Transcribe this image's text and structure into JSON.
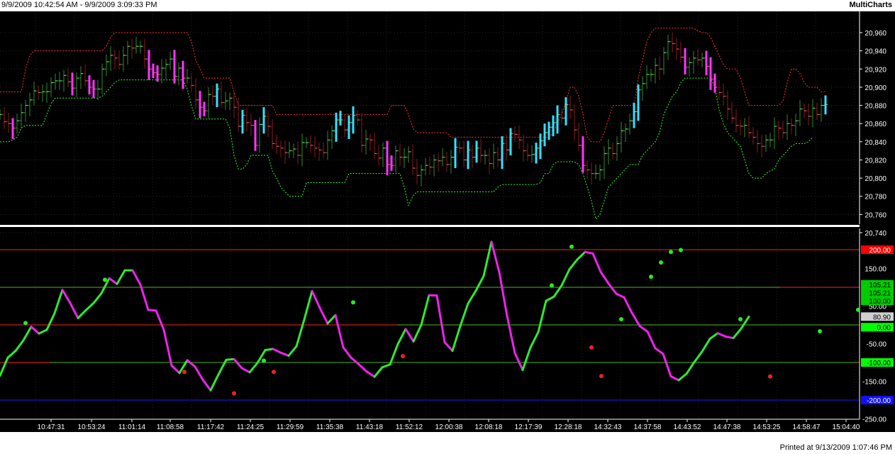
{
  "header": {
    "range": "9/9/2009 10:42:54 AM - 9/9/2009 3:09:33 PM",
    "app": "MultiCharts"
  },
  "footer": {
    "printed": "Printed at 9/13/2009 1:07:46 PM"
  },
  "colors": {
    "background": "#000000",
    "up_bar": "#2e8b2e",
    "down_bar": "#8b1a1a",
    "cyan": "#33e0ff",
    "magenta": "#ff33ff",
    "upper_band": "#ff3030",
    "lower_band": "#30ff30",
    "osc_up": "#2eea2e",
    "osc_down": "#ee22ee"
  },
  "chart_data": [
    {
      "type": "bar",
      "subtype": "ohlc-with-bands",
      "y_tick_labels": [
        "20,960",
        "20,940",
        "20,920",
        "20,900",
        "20,880",
        "20,860",
        "20,840",
        "20,820",
        "20,800",
        "20,780",
        "20,760",
        "20,740"
      ],
      "ylim": [
        20740,
        20970
      ],
      "x": [
        0,
        6,
        12,
        18,
        24,
        30,
        36,
        42,
        48,
        54,
        60,
        66,
        72,
        78,
        84,
        90,
        96,
        102,
        108,
        114,
        120,
        126,
        132,
        138,
        144,
        150,
        156,
        162,
        168,
        174,
        180,
        186,
        192,
        198,
        204,
        210,
        216,
        222,
        228,
        234,
        240,
        246,
        252,
        258,
        264,
        270,
        276,
        282,
        288,
        294,
        300,
        306,
        312,
        318,
        324,
        330,
        336,
        342,
        348,
        354,
        360,
        366,
        372,
        378,
        384,
        390,
        396,
        402,
        408,
        414,
        420,
        426,
        432,
        438,
        444,
        450,
        456,
        462,
        468,
        474,
        480,
        486,
        492,
        498,
        504,
        510,
        516,
        522,
        528,
        534,
        540,
        546,
        552,
        558,
        564,
        570,
        576,
        582,
        588,
        594,
        600,
        606,
        612,
        618,
        624,
        630,
        636,
        642,
        648,
        654,
        660,
        666,
        672,
        678,
        684,
        690,
        696,
        702,
        708,
        714,
        720,
        726,
        732,
        738,
        744,
        750,
        756,
        762,
        768,
        774,
        780,
        786,
        792,
        798,
        804,
        810,
        816,
        822,
        828,
        834,
        840,
        846,
        852,
        858,
        864,
        870,
        876,
        882,
        888,
        894,
        900,
        906,
        912,
        918,
        924,
        930,
        936,
        942,
        948,
        954,
        960,
        966,
        972,
        978,
        984,
        990,
        996,
        1002,
        1008,
        1014,
        1020,
        1026,
        1032,
        1038,
        1044,
        1050,
        1056,
        1062,
        1068,
        1074,
        1080,
        1086,
        1092,
        1098,
        1104,
        1110,
        1116,
        1122,
        1128,
        1134,
        1140,
        1146,
        1152,
        1158,
        1164,
        1170,
        1176,
        1182,
        1188,
        1194,
        1200
      ],
      "close": [
        20870,
        20862,
        20860,
        20855,
        20863,
        20872,
        20880,
        20886,
        20896,
        20894,
        20895,
        20895,
        20905,
        20907,
        20907,
        20913,
        20906,
        20899,
        20910,
        20915,
        20907,
        20900,
        20898,
        20898,
        20920,
        20928,
        20935,
        20932,
        20925,
        20935,
        20945,
        20943,
        20945,
        20945,
        20931,
        20920,
        20916,
        20914,
        20921,
        20925,
        20931,
        20912,
        20921,
        20910,
        20910,
        20902,
        20886,
        20878,
        20874,
        20892,
        20890,
        20898,
        20883,
        20885,
        20888,
        20878,
        20857,
        20869,
        20861,
        20858,
        20836,
        20859,
        20868,
        20857,
        20838,
        20835,
        20833,
        20828,
        20830,
        20832,
        20825,
        20839,
        20839,
        20836,
        20833,
        20831,
        20828,
        20842,
        20852,
        20864,
        20864,
        20853,
        20861,
        20869,
        20864,
        20836,
        20843,
        20842,
        20827,
        20822,
        20833,
        20815,
        20814,
        20830,
        20823,
        20823,
        20829,
        20811,
        20803,
        20809,
        20814,
        20812,
        20820,
        20819,
        20823,
        20815,
        20823,
        20834,
        20833,
        20820,
        20831,
        20823,
        20833,
        20825,
        20825,
        20816,
        20828,
        20820,
        20838,
        20831,
        20849,
        20848,
        20842,
        20830,
        20825,
        20826,
        20833,
        20841,
        20850,
        20856,
        20861,
        20870,
        20866,
        20881,
        20875,
        20853,
        20836,
        20814,
        20809,
        20805,
        20805,
        20809,
        20827,
        20833,
        20827,
        20838,
        20852,
        20854,
        20863,
        20873,
        20897,
        20904,
        20914,
        20914,
        20924,
        20920,
        20938,
        20950,
        20948,
        20942,
        20933,
        20922,
        20927,
        20932,
        20930,
        20932,
        20923,
        20909,
        20900,
        20894,
        20890,
        20876,
        20866,
        20858,
        20857,
        20858,
        20850,
        20845,
        20838,
        20835,
        20842,
        20842,
        20857,
        20855,
        20850,
        20860,
        20858,
        20863,
        20876,
        20874,
        20868,
        20877,
        20870,
        20880,
        20881
      ],
      "upper_band": [
        20895,
        20895,
        20895,
        20895,
        20895,
        20895,
        20920,
        20935,
        20940,
        20940,
        20940,
        20940,
        20940,
        20940,
        20940,
        20940,
        20940,
        20940,
        20940,
        20940,
        20940,
        20940,
        20940,
        20940,
        20940,
        20945,
        20955,
        20960,
        20960,
        20960,
        20960,
        20960,
        20960,
        20960,
        20960,
        20960,
        20960,
        20960,
        20960,
        20960,
        20960,
        20960,
        20960,
        20960,
        20960,
        20950,
        20930,
        20920,
        20910,
        20910,
        20910,
        20910,
        20910,
        20910,
        20910,
        20895,
        20880,
        20880,
        20880,
        20880,
        20880,
        20880,
        20880,
        20880,
        20880,
        20870,
        20870,
        20870,
        20870,
        20870,
        20870,
        20870,
        20870,
        20870,
        20870,
        20870,
        20870,
        20870,
        20870,
        20870,
        20870,
        20870,
        20870,
        20870,
        20870,
        20870,
        20870,
        20870,
        20870,
        20870,
        20870,
        20870,
        20880,
        20880,
        20880,
        20880,
        20870,
        20855,
        20850,
        20850,
        20850,
        20850,
        20850,
        20850,
        20850,
        20850,
        20845,
        20845,
        20845,
        20845,
        20845,
        20845,
        20845,
        20845,
        20845,
        20845,
        20845,
        20845,
        20845,
        20845,
        20845,
        20845,
        20845,
        20845,
        20845,
        20845,
        20845,
        20845,
        20845,
        20845,
        20850,
        20860,
        20870,
        20885,
        20900,
        20900,
        20890,
        20870,
        20845,
        20840,
        20840,
        20840,
        20850,
        20865,
        20880,
        20880,
        20880,
        20880,
        20880,
        20880,
        20910,
        20930,
        20950,
        20960,
        20965,
        20965,
        20965,
        20965,
        20965,
        20965,
        20965,
        20965,
        20965,
        20965,
        20962,
        20960,
        20960,
        20955,
        20945,
        20935,
        20925,
        20920,
        20920,
        20920,
        20910,
        20895,
        20880,
        20880,
        20880,
        20880,
        20880,
        20880,
        20880,
        20880,
        20885,
        20905,
        20920,
        20920,
        20915,
        20905,
        20900,
        20900,
        20900,
        20895,
        20895
      ],
      "lower_band": [
        20840,
        20840,
        20840,
        20842,
        20845,
        20855,
        20858,
        20858,
        20858,
        20858,
        20858,
        20870,
        20882,
        20888,
        20888,
        20888,
        20888,
        20888,
        20888,
        20888,
        20888,
        20888,
        20888,
        20888,
        20890,
        20895,
        20900,
        20905,
        20908,
        20908,
        20908,
        20908,
        20908,
        20908,
        20908,
        20908,
        20908,
        20908,
        20908,
        20908,
        20908,
        20908,
        20908,
        20908,
        20898,
        20880,
        20865,
        20865,
        20865,
        20865,
        20865,
        20865,
        20865,
        20865,
        20855,
        20825,
        20810,
        20810,
        20815,
        20825,
        20825,
        20825,
        20825,
        20825,
        20808,
        20800,
        20790,
        20785,
        20780,
        20780,
        20780,
        20780,
        20795,
        20795,
        20795,
        20795,
        20795,
        20795,
        20795,
        20795,
        20795,
        20795,
        20805,
        20805,
        20805,
        20805,
        20805,
        20805,
        20805,
        20805,
        20805,
        20805,
        20805,
        20805,
        20805,
        20790,
        20770,
        20780,
        20785,
        20785,
        20785,
        20785,
        20785,
        20785,
        20785,
        20785,
        20785,
        20785,
        20785,
        20785,
        20785,
        20785,
        20785,
        20785,
        20785,
        20785,
        20785,
        20790,
        20793,
        20793,
        20793,
        20793,
        20793,
        20793,
        20793,
        20793,
        20793,
        20795,
        20805,
        20805,
        20815,
        20818,
        20818,
        20818,
        20818,
        20818,
        20815,
        20805,
        20790,
        20775,
        20755,
        20760,
        20775,
        20790,
        20795,
        20800,
        20805,
        20810,
        20815,
        20815,
        20815,
        20825,
        20830,
        20835,
        20840,
        20850,
        20870,
        20880,
        20890,
        20895,
        20905,
        20910,
        20910,
        20910,
        20910,
        20910,
        20910,
        20910,
        20900,
        20875,
        20860,
        20850,
        20845,
        20840,
        20835,
        20820,
        20805,
        20800,
        20800,
        20800,
        20805,
        20808,
        20810,
        20820,
        20825,
        20830,
        20835,
        20838,
        20838,
        20838,
        20840,
        20845
      ]
    },
    {
      "type": "line",
      "subtype": "oscillator",
      "x_tick_labels": [
        "10:47:31",
        "10:53:24",
        "11:01:14",
        "11:08:58",
        "11:17:42",
        "11:24:25",
        "11:29:59",
        "11:35:38",
        "11:43:18",
        "11:52:12",
        "12:00:38",
        "12:08:18",
        "12:17:39",
        "12:28:18",
        "14:32:43",
        "14:37:58",
        "14:43:52",
        "14:47:38",
        "14:53:25",
        "14:58:47",
        "15:04:40"
      ],
      "y_tick_labels": [
        "150.00",
        "50.00",
        "-50.00",
        "-150.00",
        "-250.00"
      ],
      "ylim": [
        -250,
        240
      ],
      "reference_lines": [
        {
          "value": 200,
          "color": "#ff2020"
        },
        {
          "value": 100,
          "color": "#ff2020"
        },
        {
          "value": 0,
          "color": "#ff2020"
        },
        {
          "value": -100,
          "color": "#ff2020"
        },
        {
          "value": -200,
          "color": "#1a1aff"
        }
      ],
      "right_labels": [
        {
          "text": "200.00",
          "value": 200,
          "bg": "#ff0000",
          "fg": "#ffffff"
        },
        {
          "text": "105.21",
          "value": 108,
          "bg": "#00cc00",
          "fg": "#000000"
        },
        {
          "text": "105.21",
          "value": 86,
          "bg": "#00cc00",
          "fg": "#000000"
        },
        {
          "text": "100.00",
          "value": 64,
          "bg": "#00cc00",
          "fg": "#000000"
        },
        {
          "text": "80.90",
          "value": 22,
          "bg": "#d0d0d0",
          "fg": "#000000"
        },
        {
          "text": "0.00",
          "value": -6,
          "bg": "#00ff00",
          "fg": "#000000"
        },
        {
          "text": "-100.00",
          "value": -100,
          "bg": "#00ff00",
          "fg": "#000000"
        },
        {
          "text": "-200.00",
          "value": -200,
          "bg": "#1010ff",
          "fg": "#ffffff"
        }
      ],
      "x": [
        0,
        11,
        22,
        33,
        44,
        55,
        66,
        77,
        88,
        99,
        110,
        121,
        132,
        143,
        154,
        165,
        176,
        187,
        198,
        209,
        220,
        231,
        242,
        253,
        264,
        275,
        286,
        297,
        308,
        319,
        330,
        341,
        352,
        363,
        374,
        385,
        396,
        407,
        418,
        429,
        440,
        451,
        462,
        473,
        484,
        495,
        506,
        517,
        528,
        539,
        550,
        561,
        572,
        583,
        594,
        605,
        616,
        627,
        638,
        649,
        660,
        671,
        682,
        693,
        704,
        715,
        726,
        737,
        748,
        759,
        770,
        781,
        792,
        803,
        814,
        825,
        836,
        847,
        858,
        869,
        880,
        891,
        902,
        913,
        924,
        935,
        946,
        957,
        968,
        979,
        990,
        1001,
        1012,
        1023,
        1034,
        1045,
        1056,
        1067,
        1078,
        1089,
        1100,
        1111,
        1122,
        1133,
        1144,
        1155,
        1166,
        1177,
        1188,
        1199,
        1210
      ],
      "values": [
        -135,
        -87,
        -69,
        -41,
        -5,
        -23,
        -13,
        31,
        93,
        58,
        18,
        39,
        58,
        84,
        124,
        109,
        145,
        145,
        107,
        40,
        38,
        -13,
        -108,
        -128,
        -94,
        -111,
        -146,
        -174,
        -132,
        -93,
        -91,
        -115,
        -126,
        -101,
        -67,
        -64,
        -74,
        -82,
        -57,
        14,
        90,
        45,
        4,
        26,
        -60,
        -87,
        -105,
        -124,
        -138,
        -113,
        -105,
        -51,
        -11,
        -44,
        0,
        79,
        78,
        -46,
        -69,
        -3,
        57,
        91,
        130,
        221,
        140,
        24,
        -75,
        -120,
        -60,
        -19,
        64,
        75,
        105,
        148,
        174,
        194,
        190,
        141,
        110,
        83,
        73,
        32,
        -3,
        -18,
        -62,
        -77,
        -137,
        -147,
        -130,
        -99,
        -71,
        -37,
        -22,
        -31,
        -35,
        -10,
        22
      ],
      "dots": [
        {
          "x": 36,
          "value": 5
        },
        {
          "x": 148,
          "value": 120
        },
        {
          "x": 260,
          "value": -125
        },
        {
          "x": 330,
          "value": -182
        },
        {
          "x": 372,
          "value": -95
        },
        {
          "x": 386,
          "value": -125
        },
        {
          "x": 498,
          "value": 60
        },
        {
          "x": 568,
          "value": -83
        },
        {
          "x": 778,
          "value": 105
        },
        {
          "x": 806,
          "value": 208
        },
        {
          "x": 834,
          "value": -60
        },
        {
          "x": 848,
          "value": -136
        },
        {
          "x": 876,
          "value": 15
        },
        {
          "x": 918,
          "value": 128
        },
        {
          "x": 932,
          "value": 166
        },
        {
          "x": 946,
          "value": 194
        },
        {
          "x": 960,
          "value": 199
        },
        {
          "x": 1044,
          "value": 15
        },
        {
          "x": 1086,
          "value": -137
        },
        {
          "x": 1156,
          "value": -17
        },
        {
          "x": 1210,
          "value": 40
        }
      ]
    }
  ]
}
